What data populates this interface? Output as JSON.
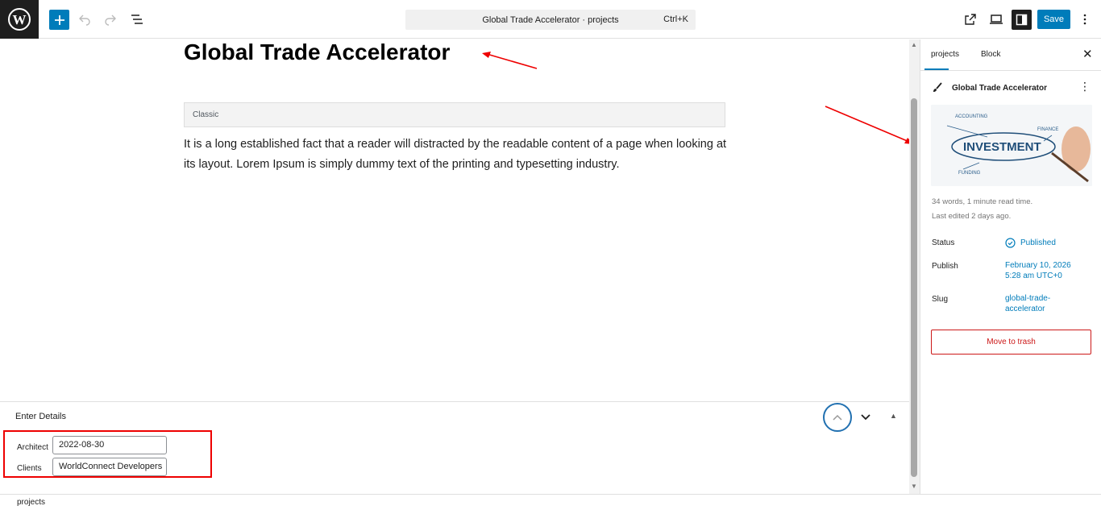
{
  "topbar": {
    "command_title": "Global Trade Accelerator · projects",
    "shortcut": "Ctrl+K",
    "save_label": "Save"
  },
  "editor": {
    "post_title": "Global Trade Accelerator",
    "classic_label": "Classic",
    "paragraph": "It is a long established fact that a reader will distracted by the readable content of a page when looking at its layout. Lorem Ipsum is simply dummy text of the printing and typesetting industry."
  },
  "metabox": {
    "title": "Enter Details",
    "fields": [
      {
        "label": "Architect",
        "value": "2022-08-30"
      },
      {
        "label": "Clients",
        "value": "WorldConnect Developers"
      }
    ]
  },
  "footer": {
    "breadcrumb": "projects"
  },
  "sidebar": {
    "tabs": [
      "projects",
      "Block"
    ],
    "post_name": "Global Trade Accelerator",
    "reading_stats": "34 words, 1 minute read time.",
    "last_edited": "Last edited 2 days ago.",
    "status_label": "Status",
    "status_value": "Published",
    "publish_label": "Publish",
    "publish_value_1": "February 10, 2026",
    "publish_value_2": "5:28 am UTC+0",
    "slug_label": "Slug",
    "slug_value_1": "global-trade-",
    "slug_value_2": "accelerator",
    "trash_label": "Move to trash",
    "thumb_words": [
      "ACCOUNTING",
      "FINANCE",
      "INVESTMENT",
      "FUNDING"
    ]
  },
  "colors": {
    "accent": "#007cba",
    "danger": "#cc1818",
    "annotation": "#e00000"
  }
}
